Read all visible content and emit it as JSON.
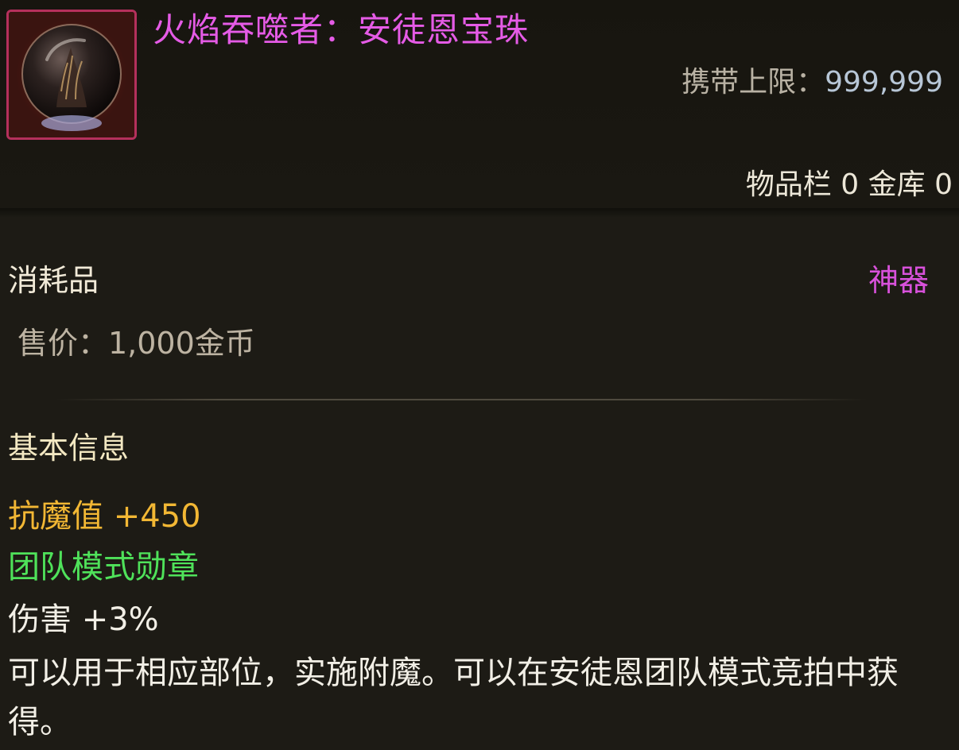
{
  "item": {
    "name": "火焰吞噬者：安徒恩宝珠",
    "icon": "fire-orb-icon",
    "carry_limit_label": "携带上限：",
    "carry_limit_value": "999,999",
    "inventory_count": "物品栏 0 金库 0",
    "type": "消耗品",
    "grade": "神器",
    "sell_price": "售价：1,000金币"
  },
  "basic_info": {
    "title": "基本信息",
    "resist": "抗魔值 +450",
    "set_name": "团队模式勋章",
    "damage": "伤害 +3%",
    "description": "可以用于相应部位，实施附魔。可以在安徒恩团队模式竞拍中获得。"
  },
  "colors": {
    "background": "#1d1b15",
    "name": "#e55be6",
    "grade": "#d851db",
    "resist": "#f2b734",
    "set_name": "#4fe25a",
    "icon_border": "#b5305c"
  }
}
